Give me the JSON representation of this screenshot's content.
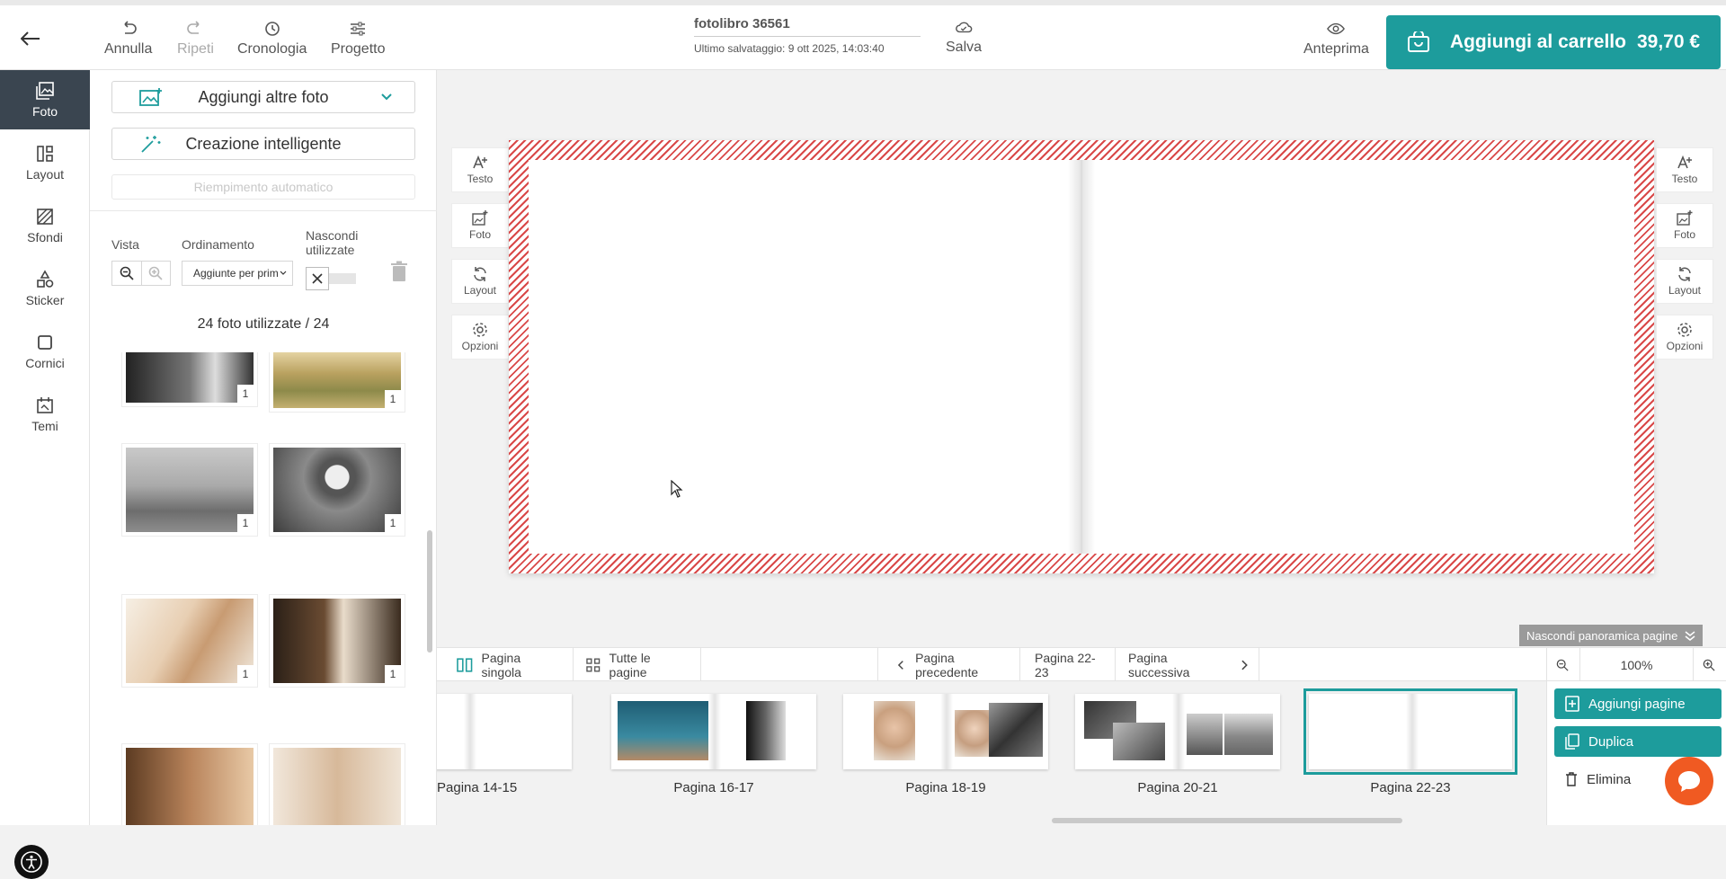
{
  "header": {
    "undo_label": "Annulla",
    "redo_label": "Ripeti",
    "history_label": "Cronologia",
    "project_label": "Progetto",
    "project_name": "fotolibro 36561",
    "last_saved_label": "Ultimo salvataggio:",
    "last_saved_value": "9 ott 2025, 14:03:40",
    "save_label": "Salva",
    "preview_label": "Anteprima",
    "cart_label": "Aggiungi al carrello",
    "cart_price": "39,70 €"
  },
  "sidebar": {
    "items": [
      {
        "label": "Foto",
        "icon": "photo-icon",
        "active": true
      },
      {
        "label": "Layout",
        "icon": "layout-icon"
      },
      {
        "label": "Sfondi",
        "icon": "background-icon"
      },
      {
        "label": "Sticker",
        "icon": "sticker-icon"
      },
      {
        "label": "Cornici",
        "icon": "frame-icon"
      },
      {
        "label": "Temi",
        "icon": "theme-icon"
      }
    ]
  },
  "panel": {
    "add_photos_label": "Aggiungi altre foto",
    "smart_creation_label": "Creazione intelligente",
    "auto_fill_label": "Riempimento automatico",
    "view_label": "Vista",
    "sort_label": "Ordinamento",
    "sort_value": "Aggiunte per prim",
    "hide_used_label": "Nascondi utilizzate",
    "used_count": "24 foto utilizzate / 24",
    "photo_badges": [
      "1",
      "1",
      "1",
      "1",
      "1",
      "1"
    ]
  },
  "tools": {
    "text_label": "Testo",
    "photo_label": "Foto",
    "layout_label": "Layout",
    "options_label": "Opzioni"
  },
  "pagenav": {
    "hide_overview_label": "Nascondi panoramica pagine",
    "single_page_label": "Pagina singola",
    "all_pages_label": "Tutte le pagine",
    "prev_label": "Pagina precedente",
    "current_label": "Pagina 22-23",
    "next_label": "Pagina successiva",
    "zoom_value": "100%"
  },
  "thumbnails": [
    {
      "label": "Pagina 14-15"
    },
    {
      "label": "Pagina 16-17"
    },
    {
      "label": "Pagina 18-19"
    },
    {
      "label": "Pagina 20-21"
    },
    {
      "label": "Pagina 22-23",
      "active": true
    }
  ],
  "actions": {
    "add_pages_label": "Aggiungi pagine",
    "duplicate_label": "Duplica",
    "delete_label": "Elimina"
  },
  "colors": {
    "accent": "#1d9c9c",
    "bleed": "#d94848",
    "sidebar_active": "#3a4550",
    "chat": "#f05a22"
  }
}
